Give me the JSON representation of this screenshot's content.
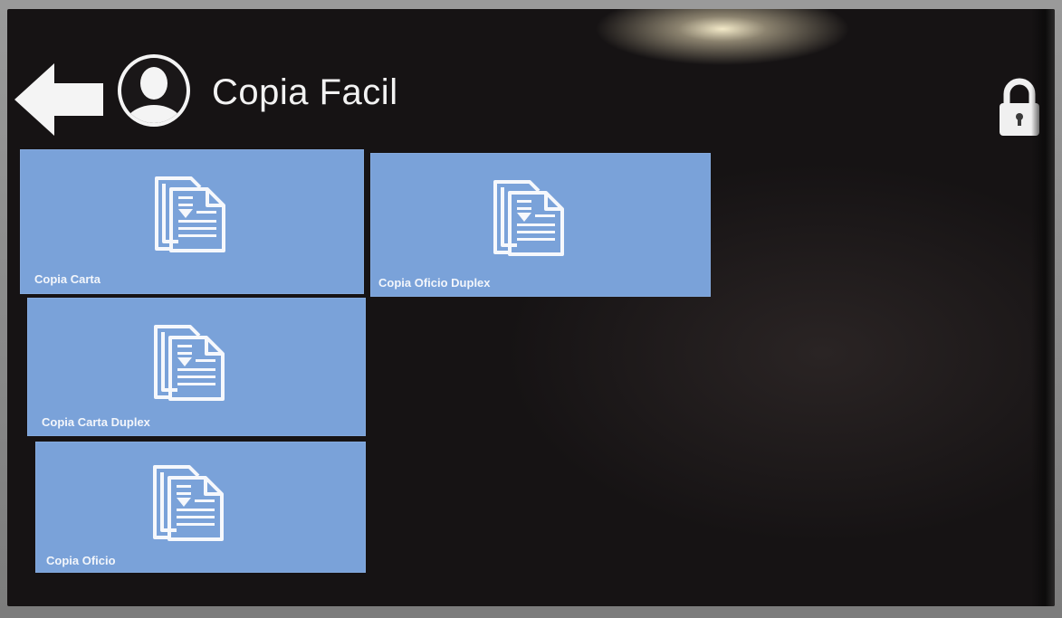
{
  "header": {
    "title": "Copia Facil",
    "back_icon": "back-arrow-icon",
    "user_icon": "user-avatar-icon",
    "lock_icon": "lock-icon"
  },
  "tiles": [
    {
      "label": "Copia Carta",
      "icon": "copy-documents-icon"
    },
    {
      "label": "Copia Oficio Duplex",
      "icon": "copy-documents-icon"
    },
    {
      "label": "Copia Carta Duplex",
      "icon": "copy-documents-icon"
    },
    {
      "label": "Copia Oficio",
      "icon": "copy-documents-icon"
    }
  ],
  "colors": {
    "tile_background": "#7aa2d9",
    "screen_background": "#141213",
    "foreground": "#f2f2f2"
  }
}
